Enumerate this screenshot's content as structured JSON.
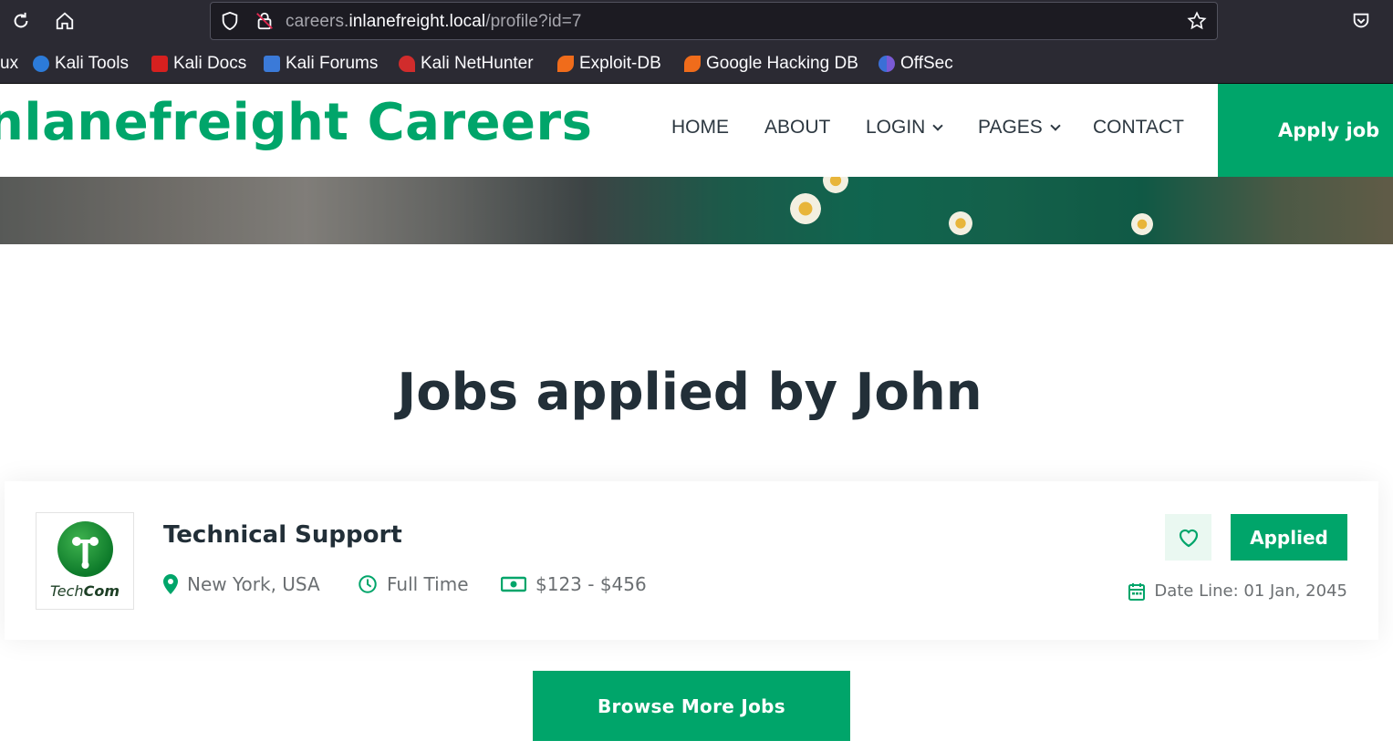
{
  "browser": {
    "url_prefix": "careers.",
    "url_domain": "inlanefreight.local",
    "url_path": "/profile?id=7",
    "bookmarks": [
      {
        "label": "ux"
      },
      {
        "label": "Kali Tools",
        "icon": "kali-tools-icon"
      },
      {
        "label": "Kali Docs",
        "icon": "kali-docs-icon"
      },
      {
        "label": "Kali Forums",
        "icon": "kali-forums-icon"
      },
      {
        "label": "Kali NetHunter",
        "icon": "kali-nethunter-icon"
      },
      {
        "label": "Exploit-DB",
        "icon": "exploit-db-icon"
      },
      {
        "label": "Google Hacking DB",
        "icon": "google-hacking-db-icon"
      },
      {
        "label": "OffSec",
        "icon": "offsec-icon"
      }
    ]
  },
  "site": {
    "brand": "nlanefreight Careers",
    "nav": [
      "HOME",
      "ABOUT",
      "LOGIN",
      "PAGES",
      "CONTACT"
    ],
    "apply_job": "Apply job",
    "accent_color": "#00a56a"
  },
  "main": {
    "title": "Jobs applied by John",
    "job": {
      "company_logo_text_a": "Tech",
      "company_logo_text_b": "Com",
      "title": "Technical Support",
      "location": "New York, USA",
      "type": "Full Time",
      "salary": "$123 - $456",
      "status": "Applied",
      "dateline": "Date Line: 01 Jan, 2045"
    },
    "browse_more": "Browse More Jobs"
  }
}
